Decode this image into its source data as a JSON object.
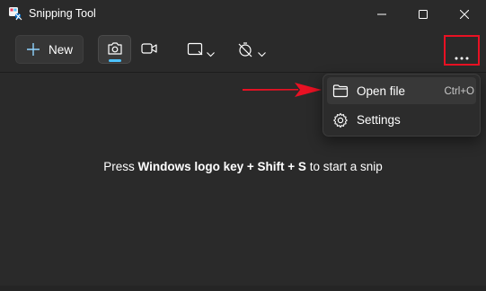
{
  "window": {
    "title": "Snipping Tool"
  },
  "toolbar": {
    "new_label": "New",
    "modes": [
      "camera-icon",
      "video-camera-icon"
    ],
    "selected_mode": "snip",
    "accent_color": "#4cc2ff",
    "highlight_color": "#e81123"
  },
  "content": {
    "hint_prefix": "Press ",
    "hint_keys": "Windows logo key + Shift + S",
    "hint_suffix": " to start a snip"
  },
  "menu": {
    "items": [
      {
        "label": "Open file",
        "shortcut": "Ctrl+O",
        "icon": "folder-icon"
      },
      {
        "label": "Settings",
        "shortcut": "",
        "icon": "gear-icon"
      }
    ]
  },
  "annotation": {
    "arrow_color": "#e81123"
  }
}
